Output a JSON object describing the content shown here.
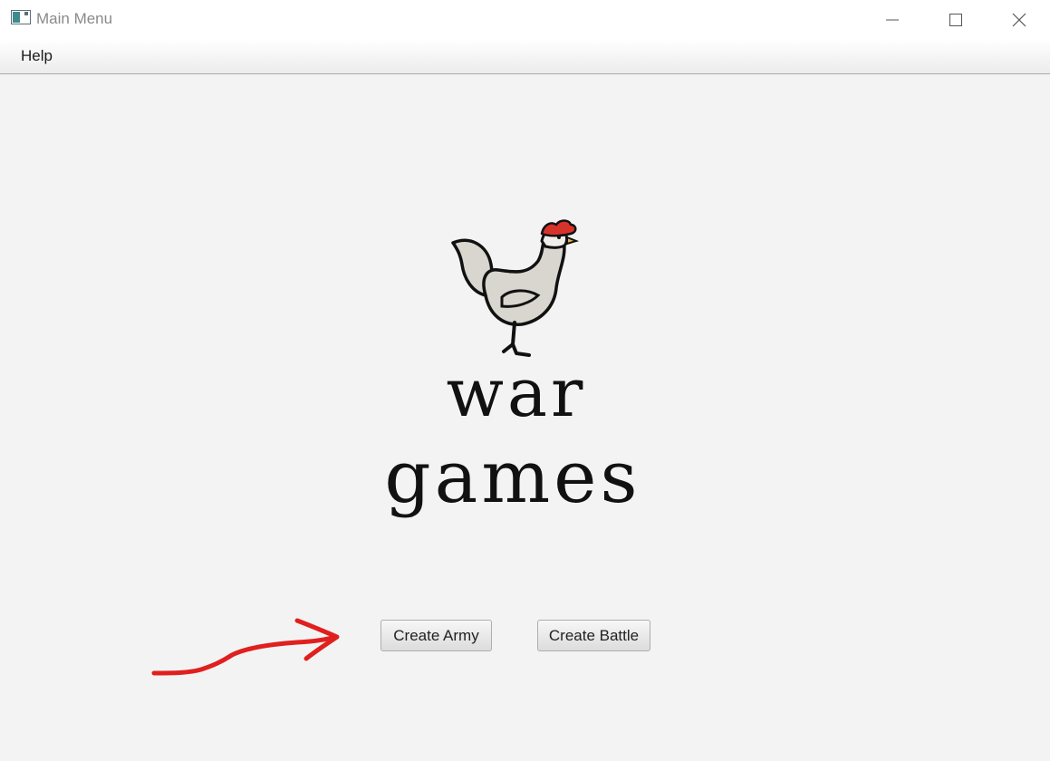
{
  "window": {
    "title": "Main Menu",
    "controls": {
      "minimize": "minimize-icon",
      "maximize": "maximize-icon",
      "close": "close-icon"
    }
  },
  "menubar": {
    "items": [
      {
        "label": "Help"
      }
    ]
  },
  "logo": {
    "line1": "war",
    "line2": "games",
    "icon": "rooster-icon"
  },
  "buttons": {
    "create_army": "Create Army",
    "create_battle": "Create Battle"
  },
  "annotation": {
    "icon": "arrow-icon",
    "color": "#e0201e"
  },
  "colors": {
    "background": "#f3f3f3",
    "titlebar": "#ffffff",
    "title_text": "#8a8a8a",
    "comb": "#d8332a"
  }
}
